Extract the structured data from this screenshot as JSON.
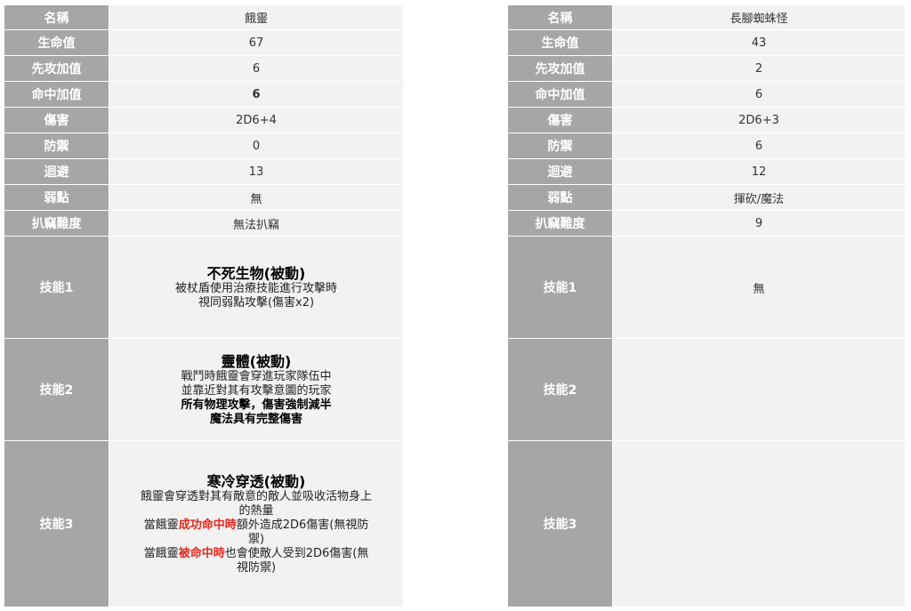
{
  "left": {
    "rows": [
      {
        "label": "名稱",
        "value": "餓靈"
      },
      {
        "label": "生命值",
        "value": "67"
      },
      {
        "label": "先攻加值",
        "value": "6"
      },
      {
        "label": "命中加值",
        "value": "6"
      },
      {
        "label": "傷害",
        "value": "2D6+4"
      },
      {
        "label": "防禦",
        "value": "0"
      },
      {
        "label": "迴避",
        "value": "13"
      },
      {
        "label": "弱點",
        "value": "無"
      },
      {
        "label": "扒竊難度",
        "value": "無法扒竊"
      }
    ],
    "skills": [
      {
        "label": "技能1",
        "title": "不死生物(被動)",
        "lines": [
          "被杖盾使用治療技能進行攻擊時",
          "視同弱點攻擊(傷害x2)"
        ]
      },
      {
        "label": "技能2",
        "title": "靈體(被動)",
        "lines": [
          "戰鬥時餓靈會穿進玩家隊伍中",
          "並靠近對其有攻擊意圖的玩家"
        ],
        "bold_lines": [
          "所有物理攻擊，傷害強制減半",
          "魔法具有完整傷害"
        ]
      },
      {
        "label": "技能3",
        "title": "寒冷穿透(被動)",
        "lines": [
          "餓靈會穿透對其有敵意的敵人並吸收活物身上",
          "的熱量"
        ],
        "line3": {
          "pre": "當餓靈",
          "red": "成功命中時",
          "post1": "額外造成2D6傷害(無視防",
          "post2": "禦)"
        },
        "line4": {
          "pre": "當餓靈",
          "red": "被命中時",
          "post1": "也會使敵人受到2D6傷害(無",
          "post2": "視防禦)"
        }
      }
    ]
  },
  "right": {
    "rows": [
      {
        "label": "名稱",
        "value": "長腳蜘蛛怪"
      },
      {
        "label": "生命值",
        "value": "43"
      },
      {
        "label": "先攻加值",
        "value": "2"
      },
      {
        "label": "命中加值",
        "value": "6"
      },
      {
        "label": "傷害",
        "value": "2D6+3"
      },
      {
        "label": "防禦",
        "value": "6"
      },
      {
        "label": "迴避",
        "value": "12"
      },
      {
        "label": "弱點",
        "value": "揮砍/魔法"
      },
      {
        "label": "扒竊難度",
        "value": "9"
      }
    ],
    "skills": [
      {
        "label": "技能1",
        "value": "無"
      },
      {
        "label": "技能2",
        "value": ""
      },
      {
        "label": "技能3",
        "value": ""
      }
    ]
  }
}
